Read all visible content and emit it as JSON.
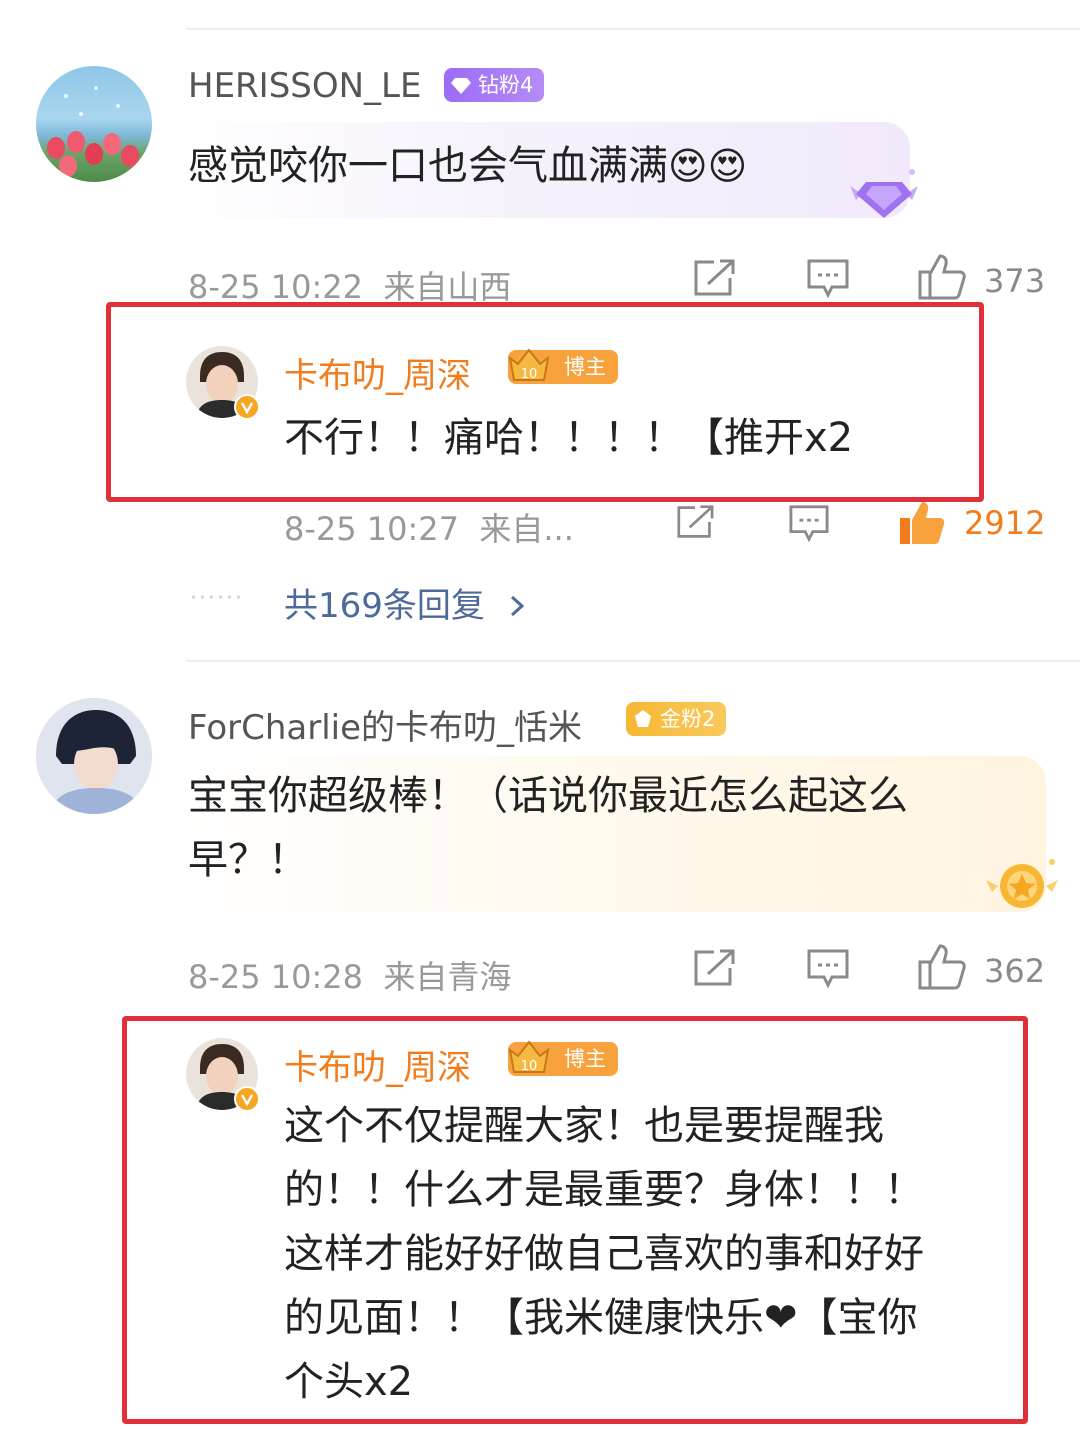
{
  "comments": [
    {
      "user": "HERISSON_LE",
      "badge": "钻粉4",
      "text": "感觉咬你一口也会气血满满",
      "emoji": "😍😍",
      "time": "8-25 10:22",
      "location": "来自山西",
      "likes": "373"
    },
    {
      "user": "ForCharlie的卡布叻_恬米",
      "badge": "金粉2",
      "text_line1": "宝宝你超级棒！（话说你最近怎么起这么",
      "text_line2": "早？！",
      "time": "8-25 10:28",
      "location": "来自青海",
      "likes": "362"
    }
  ],
  "replies": [
    {
      "user": "卡布叻_周深",
      "badge": "博主",
      "badge_level": "10",
      "text": "不行！！痛哈！！！！【推开x2",
      "time": "8-25 10:27",
      "location": "来自...",
      "likes": "2912"
    },
    {
      "user": "卡布叻_周深",
      "badge": "博主",
      "badge_level": "10",
      "lines": [
        "这个不仅提醒大家！也是要提醒我",
        "的！！什么才是最重要？身体！！！",
        "这样才能好好做自己喜欢的事和好好",
        "的见面！！【我米健康快乐❤【宝你",
        "个头x2"
      ]
    }
  ],
  "more_replies": "共169条回复",
  "dots": "······",
  "colors": {
    "blogger_name": "#f27b1c",
    "highlight_box": "#e0303a",
    "link": "#4e6a9a",
    "diamond_badge": "#a070f0",
    "gold_badge": "#f7b733"
  }
}
